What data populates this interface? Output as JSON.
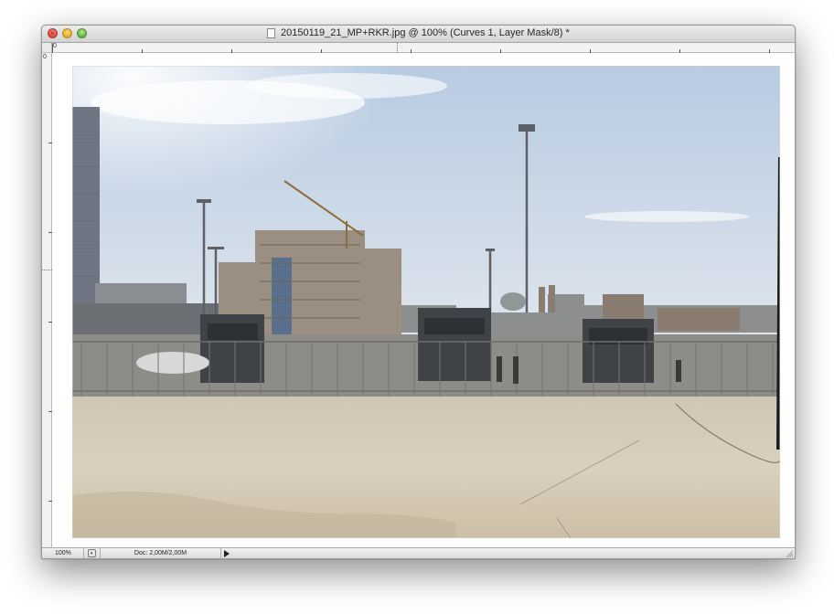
{
  "window": {
    "title": "20150119_21_MP+RKR.jpg @ 100% (Curves 1, Layer Mask/8) *",
    "close_glyph": "×"
  },
  "rulers": {
    "horizontal_origin": "0",
    "vertical_origin": "0"
  },
  "status": {
    "zoom": "100%",
    "doc_info": "Doc: 2,00M/2,00M"
  },
  "icons": {
    "document": "document-icon",
    "status_menu": "status-menu-arrow-icon",
    "resize": "resize-grip-icon"
  },
  "colors": {
    "sky_top": "#c2d3e6",
    "sky_bottom": "#e9ecef",
    "pavement": "#d5cdbf",
    "close": "#e0443a",
    "minimize": "#e0a824",
    "zoom": "#5fb33d"
  }
}
